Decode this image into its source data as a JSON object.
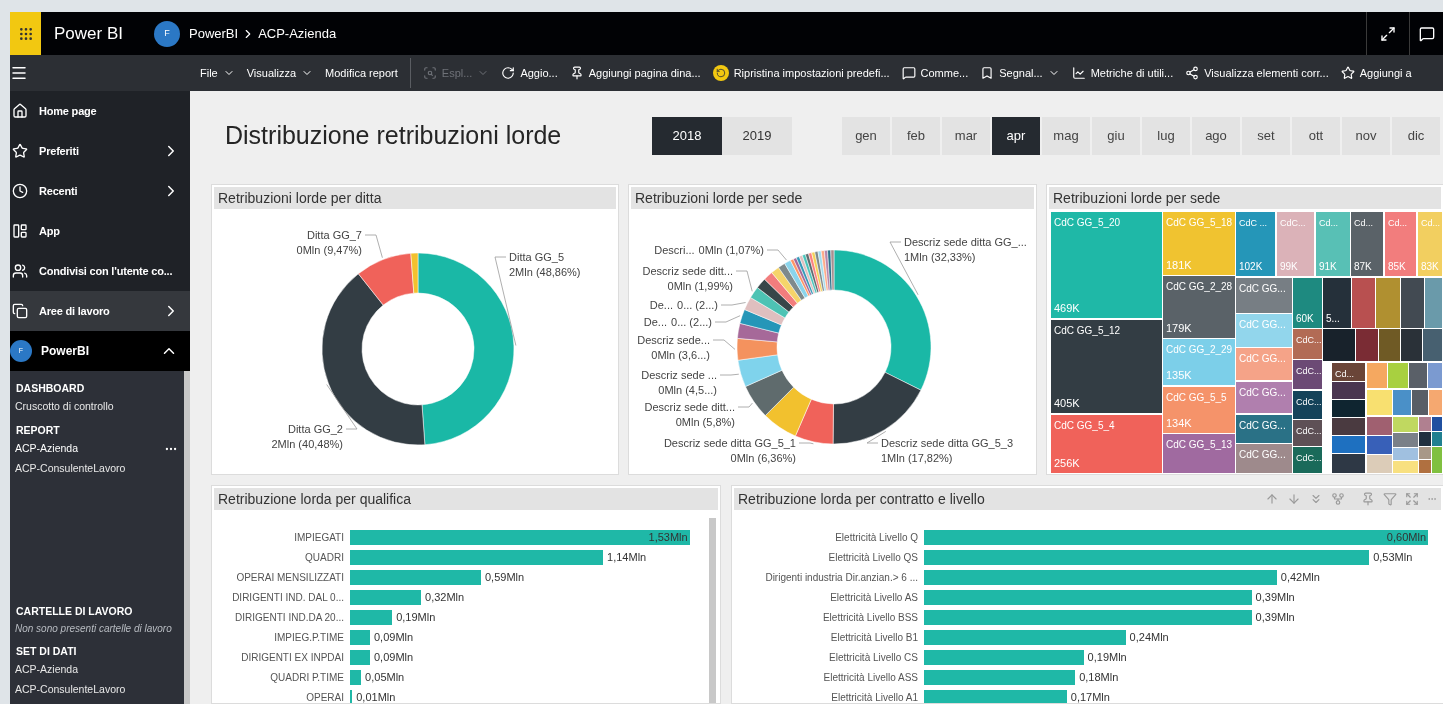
{
  "app": {
    "name": "Power BI",
    "avatar": "F",
    "breadcrumb": [
      "PowerBI",
      "ACP-Azienda"
    ]
  },
  "toolbar": [
    {
      "label": "File",
      "dropdown": true,
      "disabled": false,
      "separator_before": false
    },
    {
      "label": "Visualizza",
      "dropdown": true,
      "disabled": false,
      "separator_before": false
    },
    {
      "label": "Modifica report",
      "dropdown": false,
      "disabled": false,
      "separator_before": false
    },
    {
      "label": "Espl...",
      "dropdown": true,
      "disabled": true,
      "separator_before": true
    },
    {
      "label": "Aggio...",
      "dropdown": false,
      "disabled": false,
      "separator_before": false
    },
    {
      "label": "Aggiungi pagina dina...",
      "dropdown": false,
      "disabled": false,
      "separator_before": false
    },
    {
      "label": "Ripristina impostazioni predefi...",
      "dropdown": false,
      "disabled": false,
      "separator_before": false
    },
    {
      "label": "Comme...",
      "dropdown": false,
      "disabled": false,
      "separator_before": false
    },
    {
      "label": "Segnal...",
      "dropdown": true,
      "disabled": false,
      "separator_before": false
    },
    {
      "label": "Metriche di utili...",
      "dropdown": false,
      "disabled": false,
      "separator_before": false
    },
    {
      "label": "Visualizza elementi corr...",
      "dropdown": false,
      "disabled": false,
      "separator_before": false
    },
    {
      "label": "Aggiungi a",
      "dropdown": false,
      "disabled": false,
      "separator_before": false
    }
  ],
  "sidebar": {
    "items": [
      {
        "label": "Home page",
        "selected": false
      },
      {
        "label": "Preferiti",
        "expanded": false,
        "selected": false
      },
      {
        "label": "Recenti",
        "expanded": false,
        "selected": false
      },
      {
        "label": "App",
        "selected": false
      },
      {
        "label": "Condivisi con l'utente co...",
        "selected": false
      },
      {
        "label": "Aree di lavoro",
        "expanded": false,
        "selected": true
      }
    ],
    "workspace": {
      "label": "PowerBI",
      "avatar": "F",
      "expanded": true
    },
    "top_sections": [
      {
        "heading": "DASHBOARD",
        "items": [
          {
            "label": "Cruscotto di controllo",
            "selected": false
          }
        ]
      },
      {
        "heading": "REPORT",
        "items": [
          {
            "label": "ACP-Azienda",
            "selected": true
          },
          {
            "label": "ACP-ConsulenteLavoro",
            "selected": false
          }
        ]
      }
    ],
    "bottom_sections": [
      {
        "heading": "CARTELLE DI LAVORO",
        "note": "Non sono presenti cartelle di lavoro"
      },
      {
        "heading": "SET DI DATI",
        "items": [
          {
            "label": "ACP-Azienda",
            "selected": false
          },
          {
            "label": "ACP-ConsulenteLavoro",
            "selected": false
          }
        ]
      }
    ]
  },
  "report": {
    "title": "Distribuzione retribuzioni lorde",
    "years": [
      {
        "label": "2018",
        "selected": true
      },
      {
        "label": "2019",
        "selected": false
      }
    ],
    "months": [
      {
        "label": "gen",
        "selected": false
      },
      {
        "label": "feb",
        "selected": false
      },
      {
        "label": "mar",
        "selected": false
      },
      {
        "label": "apr",
        "selected": true
      },
      {
        "label": "mag",
        "selected": false
      },
      {
        "label": "giu",
        "selected": false
      },
      {
        "label": "lug",
        "selected": false
      },
      {
        "label": "ago",
        "selected": false
      },
      {
        "label": "set",
        "selected": false
      },
      {
        "label": "ott",
        "selected": false
      },
      {
        "label": "nov",
        "selected": false
      },
      {
        "label": "dic",
        "selected": false
      }
    ],
    "donut_ditta": {
      "title": "Retribuzioni lorde per ditta",
      "chart_data": {
        "type": "donut",
        "values": [
          48.86,
          40.48,
          9.47,
          1.19
        ],
        "colors": [
          "#1ab8a6",
          "#333d44",
          "#f0625a",
          "#f2c12e"
        ],
        "categories": [
          "Ditta GG_5",
          "Ditta GG_2",
          "Ditta GG_7",
          null
        ],
        "value_labels": [
          "2Mln (48,86%)",
          "2Mln (40,48%)",
          "0Mln (9,47%)",
          null
        ]
      }
    },
    "donut_sede": {
      "title": "Retribuzioni lorde per sede",
      "chart_data": {
        "type": "donut",
        "values": [
          32.33,
          17.82,
          6.36,
          6.0,
          5.8,
          4.5,
          3.6,
          2.5,
          2.4,
          2.2,
          1.99,
          1.8,
          1.6,
          1.4,
          1.2,
          1.07,
          0.53,
          0.53,
          0.53,
          0.53,
          0.53,
          0.53,
          0.53,
          0.53,
          0.53,
          0.53,
          0.53,
          0.53,
          0.53,
          0.53
        ],
        "colors": [
          "#1ab8a6",
          "#333d44",
          "#f0625a",
          "#f2c12e",
          "#5f6b6d",
          "#7fd3ec",
          "#f4925e",
          "#a66999",
          "#2596b8",
          "#dfbfbf",
          "#4dc3b4",
          "#374649",
          "#f27d7d",
          "#f5d46a",
          "#7e8a8c",
          "#8ad4eb",
          "#fe9666",
          "#a66999",
          "#3599b8",
          "#dfbfbf",
          "#4ac5bb",
          "#5f6b6d",
          "#fb8281",
          "#f4d25a",
          "#7f898a",
          "#a4ddee",
          "#fdab89",
          "#b687ac",
          "#28738a",
          "#a78f8f"
        ],
        "categories": [
          "Descriz sede ditta GG_...",
          "Descriz sede ditta GG_5_3",
          "Descriz sede ditta GG_5_1",
          null,
          "Descriz sede ditt...",
          "Descriz sede ...",
          "Descriz sede...",
          null,
          "De...",
          "De...",
          "Descriz sede ditt...",
          null,
          null,
          null,
          null,
          "Descri...",
          null,
          null,
          null,
          null,
          null,
          null,
          null,
          null,
          null,
          null,
          null,
          null,
          null,
          null
        ],
        "value_labels": [
          "1Mln (32,33%)",
          "1Mln (17,82%)",
          "0Mln (6,36%)",
          null,
          "0Mln (5,8%)",
          "0Mln (4,5...)",
          "0Mln (3,6...)",
          null,
          "0... (2...)",
          "0... (2...)",
          "0Mln (1,99%)",
          null,
          null,
          null,
          null,
          "0Mln (1,07%)",
          null,
          null,
          null,
          null,
          null,
          null,
          null,
          null,
          null,
          null,
          null,
          null,
          null,
          null
        ]
      }
    },
    "treemap": {
      "title": "Retribuzioni lorde per sede",
      "tiles": [
        {
          "texts": [
            "CdC GG_5_20",
            "469K"
          ],
          "color": "#1fb8a7"
        },
        {
          "texts": [
            "CdC GG_5_12",
            "405K"
          ],
          "color": "#333d44"
        },
        {
          "texts": [
            "CdC GG_5_4",
            "256K"
          ],
          "color": "#f0625a"
        },
        {
          "texts": [
            "CdC GG_5_18",
            "181K"
          ],
          "color": "#f0c330"
        },
        {
          "texts": [
            "CdC GG_2_28",
            "179K"
          ],
          "color": "#5a6268"
        },
        {
          "texts": [
            "CdC GG_2_29",
            "135K"
          ],
          "color": "#7ccfe9"
        },
        {
          "texts": [
            "CdC GG_5_5",
            "134K"
          ],
          "color": "#f5936a"
        },
        {
          "texts": [
            "CdC GG_5_13"
          ],
          "color": "#a06aa0"
        },
        {
          "texts": [
            "CdC ...",
            "102K"
          ],
          "color": "#2596b8"
        },
        {
          "texts": [
            "CdC...",
            "99K"
          ],
          "color": "#dbb2b8"
        },
        {
          "texts": [
            "Cd...",
            "91K"
          ],
          "color": "#58c0b5"
        },
        {
          "texts": [
            "Cd...",
            "87K"
          ],
          "color": "#5a6268"
        },
        {
          "texts": [
            "Cd...",
            "85K"
          ],
          "color": "#f27d7d"
        },
        {
          "texts": [
            "Cd...",
            "83K"
          ],
          "color": "#f2cf60"
        },
        {
          "texts": [
            "CdC GG..."
          ],
          "color": "#777e84"
        },
        {
          "texts": [
            "CdC GG..."
          ],
          "color": "#92d6ec"
        },
        {
          "texts": [
            "CdC GG..."
          ],
          "color": "#f5a388"
        },
        {
          "texts": [
            "CdC GG..."
          ],
          "color": "#b07fae"
        },
        {
          "texts": [
            "CdC GG..."
          ],
          "color": "#2a7186"
        },
        {
          "texts": [
            "CdC GG..."
          ],
          "color": "#9e8a8c"
        },
        {
          "texts": [
            "60K"
          ],
          "color": "#1e8a80"
        },
        {
          "texts": [
            "5..."
          ],
          "color": "#25303a"
        },
        {
          "texts": [
            "CdC..."
          ],
          "color": "#b26b55"
        },
        {
          "texts": [
            "CdC..."
          ],
          "color": "#6c4a75"
        },
        {
          "texts": [
            "CdC..."
          ],
          "color": "#15435a"
        },
        {
          "texts": [
            "CdC..."
          ],
          "color": "#5e5056"
        },
        {
          "texts": [
            "CdC..."
          ],
          "color": "#1a6a5a"
        },
        {
          "texts": [
            "Cd..."
          ],
          "color": "#6a4538"
        },
        {
          "color": "#b85050"
        },
        {
          "color": "#b09030"
        },
        {
          "color": "#424a52"
        },
        {
          "color": "#6a9aaa"
        },
        {
          "color": "#18222b"
        },
        {
          "color": "#7a2c34"
        },
        {
          "color": "#6f5a25"
        },
        {
          "color": "#2a3138"
        },
        {
          "color": "#476070"
        },
        {
          "color": "#4a3550"
        },
        {
          "color": "#0f2530"
        },
        {
          "color": "#4a3a40"
        },
        {
          "color": "#1e70c0"
        },
        {
          "color": "#2e3845"
        },
        {
          "color": "#f5a860"
        },
        {
          "color": "#a8d040"
        },
        {
          "color": "#5a6068"
        },
        {
          "color": "#7b9ad0"
        },
        {
          "color": "#f8e070"
        },
        {
          "color": "#4a90c8"
        },
        {
          "color": "#585e66"
        },
        {
          "color": "#f5a870"
        },
        {
          "color": "#a06070"
        },
        {
          "color": "#3860b8"
        },
        {
          "color": "#dcccb8"
        },
        {
          "color": "#c0d860"
        },
        {
          "color": "#7a8088"
        },
        {
          "color": "#a0c0e0"
        },
        {
          "color": "#f8e080"
        },
        {
          "color": "#b08090"
        },
        {
          "color": "#203040"
        },
        {
          "color": "#a89888"
        },
        {
          "color": "#b07040"
        },
        {
          "color": "#2050a0"
        },
        {
          "color": "#208090"
        },
        {
          "color": "#80c040"
        }
      ]
    },
    "bar_qualifica": {
      "title": "Retribuzione lorda per qualifica",
      "chart_data": {
        "type": "bar",
        "orientation": "horizontal",
        "categories": [
          "IMPIEGATI",
          "QUADRI",
          "OPERAI MENSILIZZATI",
          "DIRIGENTI IND. DAL 0...",
          "DIRIGENTI IND.DA 20...",
          "IMPIEG.P.TIME",
          "DIRIGENTI EX INPDAI",
          "QUADRI P.TIME",
          "OPERAI"
        ],
        "series": [
          {
            "color": "#1fb8a7",
            "values": [
              1.53,
              1.14,
              0.59,
              0.32,
              0.19,
              0.09,
              0.09,
              0.05,
              0.01
            ],
            "value_labels": [
              "1,53Mln",
              "1,14Mln",
              "0,59Mln",
              "0,32Mln",
              "0,19Mln",
              "0,09Mln",
              "0,09Mln",
              "0,05Mln",
              "0,01Mln"
            ]
          }
        ]
      }
    },
    "bar_contratto": {
      "title": "Retribuzione lorda per contratto e livello",
      "chart_data": {
        "type": "bar",
        "orientation": "horizontal",
        "categories": [
          "Elettricità Livello Q",
          "Elettricità Livello QS",
          "Dirigenti industria Dir.anzian.> 6 ...",
          "Elettricità Livello AS",
          "Elettricità Livello BSS",
          "Elettricità Livello B1",
          "Elettricità Livello CS",
          "Elettricità Livello ASS",
          "Elettricità Livello A1"
        ],
        "series": [
          {
            "color": "#1fb8a7",
            "values": [
              0.6,
              0.53,
              0.42,
              0.39,
              0.39,
              0.24,
              0.19,
              0.18,
              0.17
            ],
            "value_labels": [
              "0,60Mln",
              "0,53Mln",
              "0,42Mln",
              "0,39Mln",
              "0,39Mln",
              "0,24Mln",
              "0,19Mln",
              "0,18Mln",
              "0,17Mln"
            ]
          }
        ]
      }
    }
  }
}
